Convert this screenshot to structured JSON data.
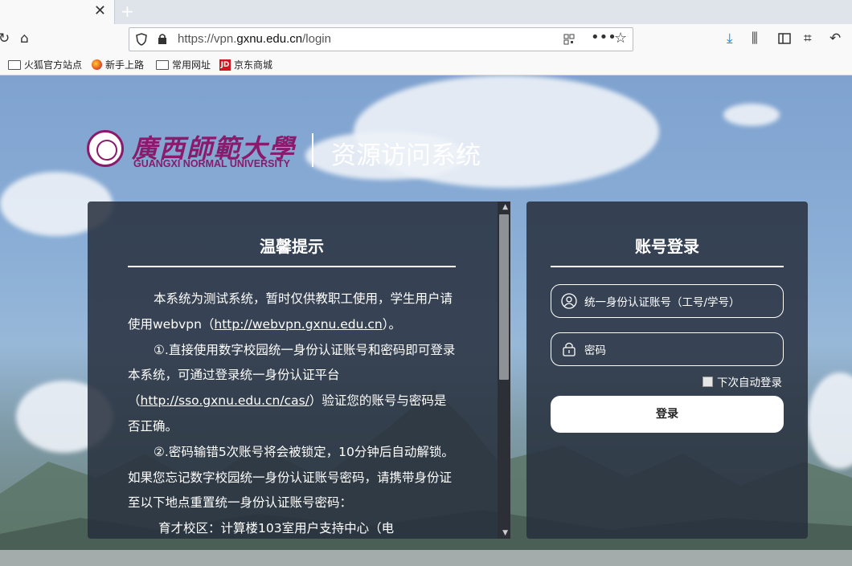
{
  "browser": {
    "url_prefix": "https://vpn.",
    "url_host": "gxnu.edu.cn",
    "url_path": "/login",
    "bookmarks": [
      "火狐官方站点",
      "新手上路",
      "常用网址",
      "京东商城"
    ]
  },
  "logo": {
    "calligraphy": "廣西師範大學",
    "english": "GUANGXI NORMAL UNIVERSITY",
    "system_title": "资源访问系统"
  },
  "notice": {
    "title": "温馨提示",
    "p1_a": "本系统为测试系统，暂时仅供教职工使用，学生用户请使用webvpn（",
    "p1_link": "http://webvpn.gxnu.edu.cn",
    "p1_b": "）。",
    "p2_a": "①.直接使用数字校园统一身份认证账号和密码即可登录本系统，可通过登录统一身份认证平台（",
    "p2_link": "http://sso.gxnu.edu.cn/cas/",
    "p2_b": "）验证您的账号与密码是否正确。",
    "p3": "②.密码输错5次账号将会被锁定，10分钟后自动解锁。如果您忘记数字校园统一身份认证账号密码，请携带身份证至以下地点重置统一身份认证账号密码：",
    "p4": "育才校区：计算楼103室用户支持中心（电"
  },
  "login": {
    "title": "账号登录",
    "username_placeholder": "统一身份认证账号（工号/学号）",
    "password_placeholder": "密码",
    "remember_label": "下次自动登录",
    "submit_label": "登录"
  }
}
